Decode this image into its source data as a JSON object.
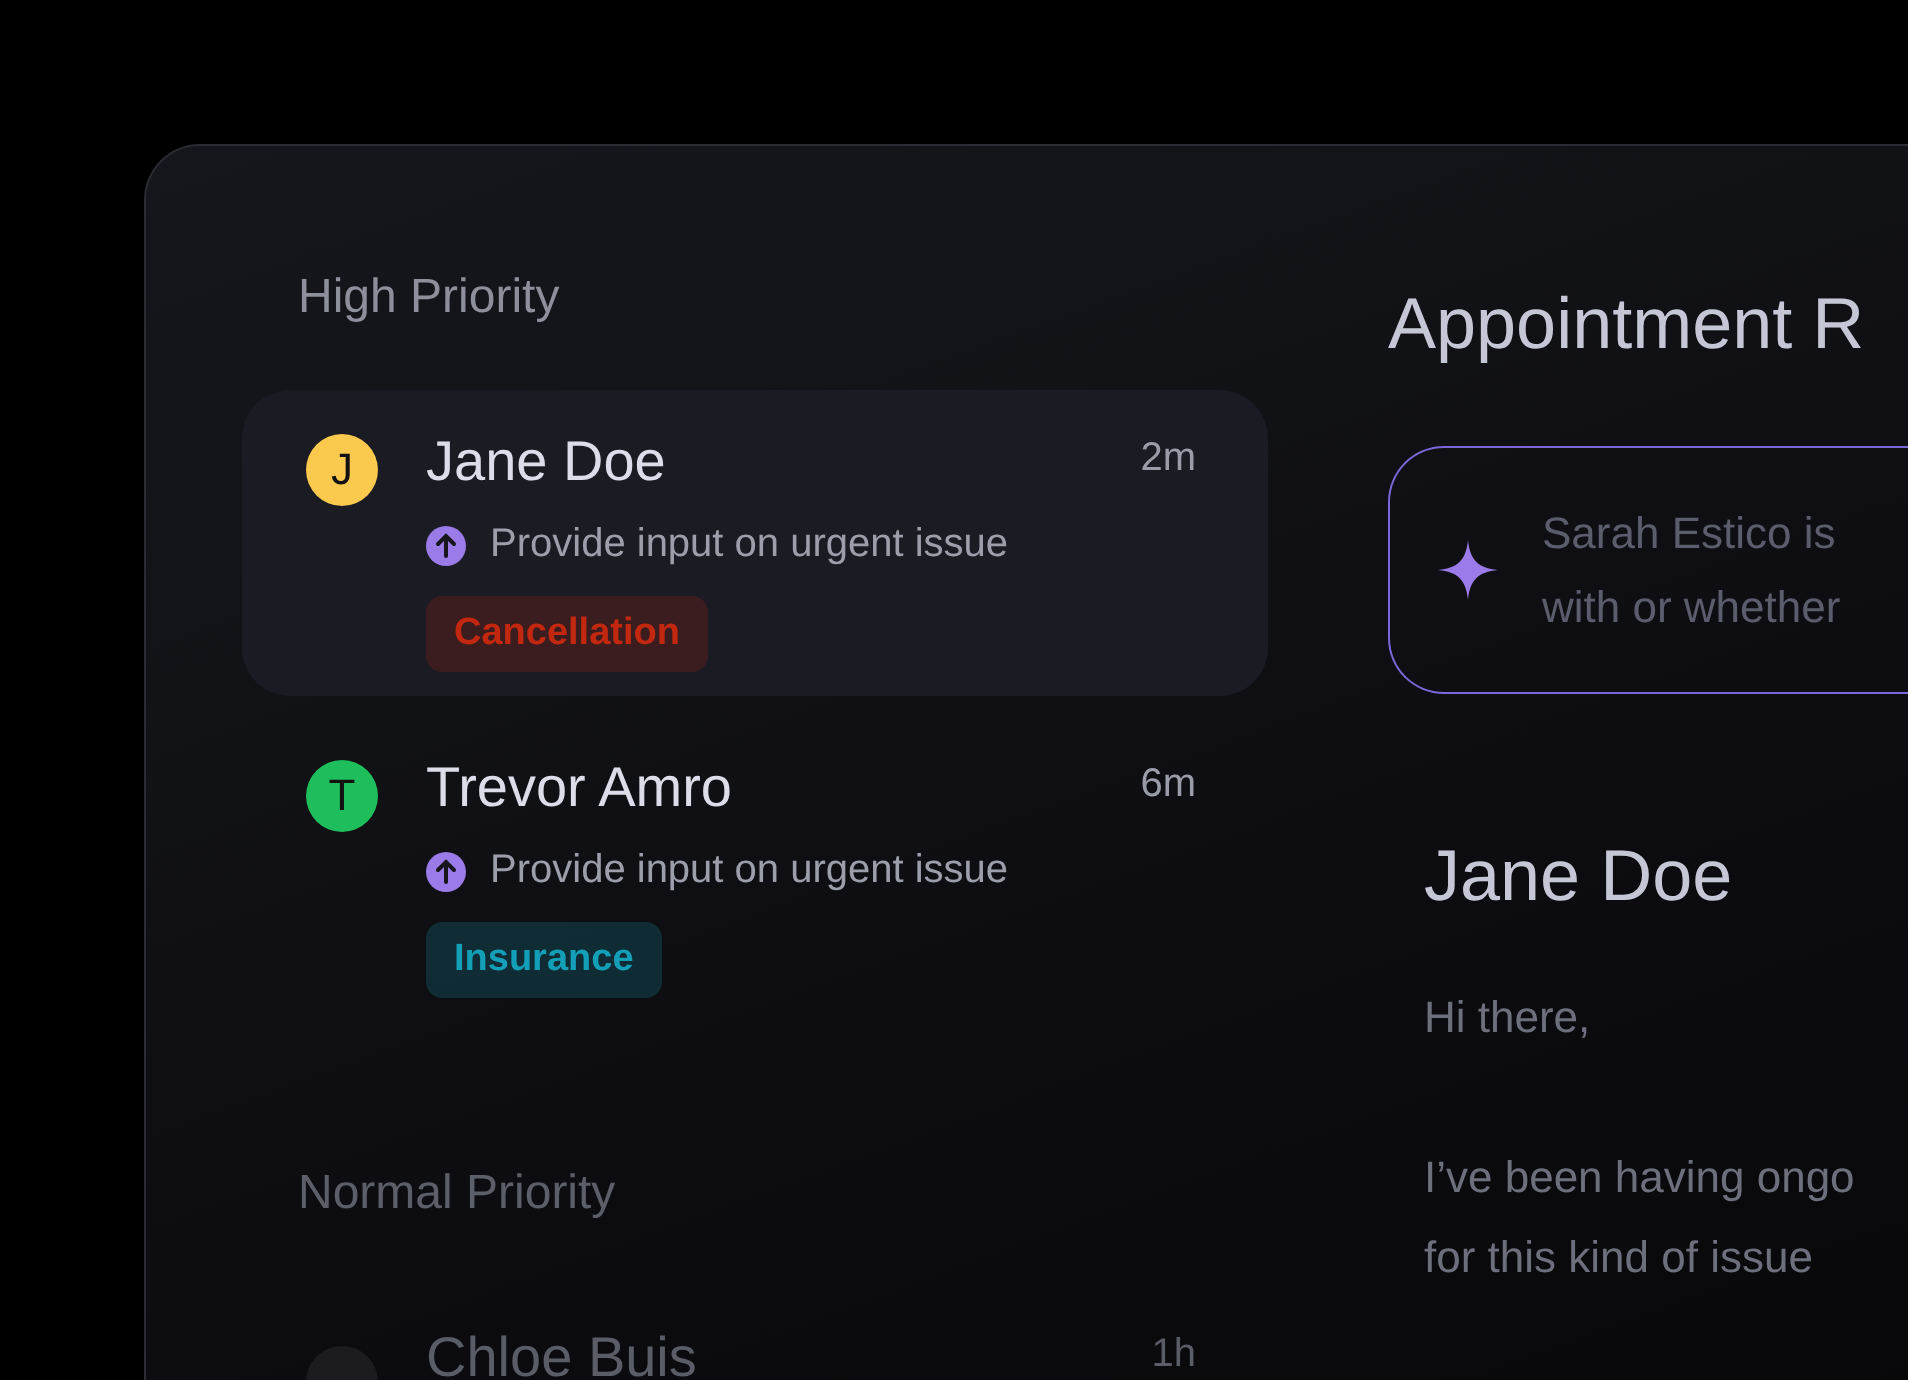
{
  "inbox": {
    "groups": [
      {
        "title": "High Priority",
        "items": [
          {
            "name": "Jane Doe",
            "avatar": {
              "initial": "J",
              "color": "#fbc94e"
            },
            "time": "2m",
            "action": "Provide input on urgent issue",
            "tag": {
              "label": "Cancellation",
              "color": "#c2280f"
            },
            "selected": true
          },
          {
            "name": "Trevor Amro",
            "avatar": {
              "initial": "T",
              "color": "#1ebe5c"
            },
            "time": "6m",
            "action": "Provide input on urgent issue",
            "tag": {
              "label": "Insurance",
              "color": "#139fb8"
            },
            "selected": false
          }
        ]
      },
      {
        "title": "Normal Priority",
        "items": [
          {
            "name": "Chloe Buis",
            "time": "1h",
            "selected": false
          }
        ]
      }
    ]
  },
  "detail": {
    "title": "Appointment R",
    "ai_summary": [
      "Sarah Estico is",
      "with or whether"
    ],
    "sender": "Jane Doe",
    "message": [
      "Hi there,",
      "I’ve been having ongo",
      "for this kind of issue"
    ]
  }
}
